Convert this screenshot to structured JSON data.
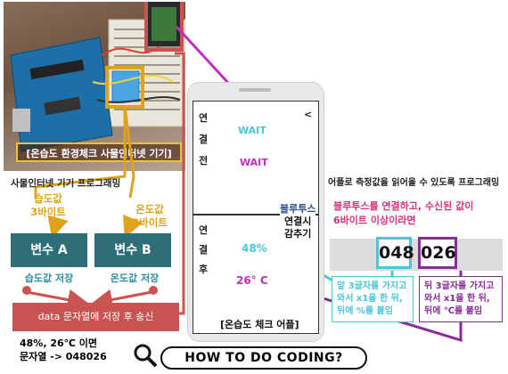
{
  "photo": {
    "caption": "[온습도 환경체크 사물인터넷 기기]"
  },
  "left": {
    "heading": "사물인터넷 기기 프로그래밍",
    "humidity_label": [
      "습도값",
      "3바이트"
    ],
    "temperature_label": [
      "온도값",
      "3바이트"
    ],
    "var_a": "변수 A",
    "var_b": "변수 B",
    "store_humidity": "습도값 저장",
    "store_temperature": "온도값 저장",
    "send_box": "data 문자열에 저장 후 송신",
    "example_line1": "48%, 26℃ 이면",
    "example_line2": "문자열 -> 048026"
  },
  "phone": {
    "chars_top": [
      "연",
      "결",
      "전"
    ],
    "chars_bottom": [
      "연",
      "결",
      "후"
    ],
    "arrow_glyph": "<",
    "wait1": "WAIT",
    "wait2": "WAIT",
    "humidity_value": "48%",
    "temperature_value": "26° C",
    "app_caption": "[온습도 체크 어플]"
  },
  "annotation": {
    "bt_line1": "블루투스",
    "bt_line2": "연결시",
    "bt_line3": "감추기"
  },
  "right": {
    "heading": "어플로 측정값을 읽어올 수 있도록 프로그래밍",
    "desc_line1": "블루투스를 연결하고, 수신된 값이",
    "desc_line2": "6바이트 이상이라면",
    "num1": "048",
    "num2": "026",
    "note1": "앞 3글자를 가지고 와서 x1을 한 뒤, 뒤에 %를 붙임",
    "note2": "뒤 3글자를 가지고 와서 x1을 한 뒤, 뒤에 ℃를 붙임"
  },
  "footer": {
    "howto": "HOW TO DO CODING?"
  },
  "colors": {
    "orange": "#e0a21a",
    "teal": "#2f6e79",
    "red": "#c95350",
    "magenta": "#c12fc1",
    "cyan": "#4bc6d8",
    "purple": "#8a2a9a",
    "navy": "#2c4f8a"
  }
}
